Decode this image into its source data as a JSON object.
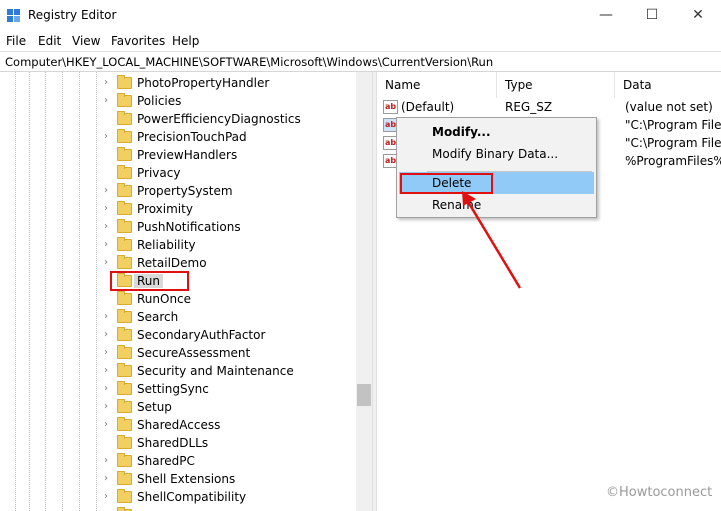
{
  "window": {
    "title": "Registry Editor",
    "controls": {
      "minimize": "—",
      "maximize": "☐",
      "close": "✕"
    }
  },
  "menu": [
    "File",
    "Edit",
    "View",
    "Favorites",
    "Help"
  ],
  "address": "Computer\\HKEY_LOCAL_MACHINE\\SOFTWARE\\Microsoft\\Windows\\CurrentVersion\\Run",
  "tree": {
    "items": [
      {
        "label": "PhotoPropertyHandler",
        "expandable": true
      },
      {
        "label": "Policies",
        "expandable": true
      },
      {
        "label": "PowerEfficiencyDiagnostics",
        "expandable": false
      },
      {
        "label": "PrecisionTouchPad",
        "expandable": true
      },
      {
        "label": "PreviewHandlers",
        "expandable": false
      },
      {
        "label": "Privacy",
        "expandable": false
      },
      {
        "label": "PropertySystem",
        "expandable": true
      },
      {
        "label": "Proximity",
        "expandable": true
      },
      {
        "label": "PushNotifications",
        "expandable": true
      },
      {
        "label": "Reliability",
        "expandable": true
      },
      {
        "label": "RetailDemo",
        "expandable": true
      },
      {
        "label": "Run",
        "expandable": false,
        "selected": true
      },
      {
        "label": "RunOnce",
        "expandable": false
      },
      {
        "label": "Search",
        "expandable": true
      },
      {
        "label": "SecondaryAuthFactor",
        "expandable": true
      },
      {
        "label": "SecureAssessment",
        "expandable": true
      },
      {
        "label": "Security and Maintenance",
        "expandable": true
      },
      {
        "label": "SettingSync",
        "expandable": true
      },
      {
        "label": "Setup",
        "expandable": true
      },
      {
        "label": "SharedAccess",
        "expandable": true
      },
      {
        "label": "SharedDLLs",
        "expandable": false
      },
      {
        "label": "SharedPC",
        "expandable": true
      },
      {
        "label": "Shell Extensions",
        "expandable": true
      },
      {
        "label": "ShellCompatibility",
        "expandable": true
      }
    ]
  },
  "list": {
    "columns": [
      "Name",
      "Type",
      "Data"
    ],
    "rows": [
      {
        "name": "(Default)",
        "type": "REG_SZ",
        "data": "(value not set)"
      },
      {
        "name": "",
        "type": "",
        "data": "\"C:\\Program Files\\"
      },
      {
        "name": "",
        "type": "",
        "data": "\"C:\\Program Files\\"
      },
      {
        "name": "",
        "type": "",
        "data": "%ProgramFiles%\\"
      }
    ],
    "value_icon": "ab"
  },
  "context_menu": {
    "items": [
      "Modify...",
      "Modify Binary Data...",
      "Delete",
      "Rename"
    ],
    "highlighted": "Delete"
  },
  "watermark": "©Howtoconnect",
  "colors": {
    "highlight_box": "#e01010",
    "menu_hover": "#91c9f7",
    "folder": "#f2cf61"
  }
}
